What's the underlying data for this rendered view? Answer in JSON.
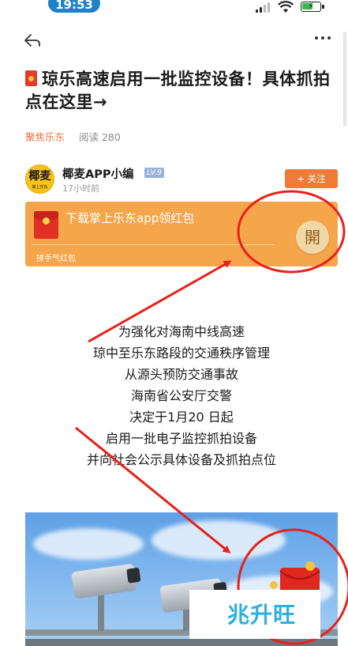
{
  "status_bar": {
    "time": "19:53"
  },
  "article": {
    "title": "琼乐高速启用一批监控设备！具体抓拍点在这里→",
    "source": "聚焦乐东",
    "read_label": "阅读 280"
  },
  "author": {
    "avatar_text": "椰麦",
    "avatar_subtext": "掌上乐东",
    "name": "椰麦APP小编",
    "level": "LV.9",
    "time": "17小时前",
    "follow_label": "+  关注"
  },
  "redpacket_banner": {
    "text": "下载掌上乐东app领红包",
    "footer": "拼手气红包",
    "open_label": "開"
  },
  "body_lines": [
    "为强化对海南中线高速",
    "琼中至乐东路段的交通秩序管理",
    "从源头预防交通事故",
    "海南省公安厅交警",
    "决定于1月20 日起",
    "启用一批电子监控抓拍设备",
    "并向社会公示具体设备及抓拍点位"
  ],
  "watermark": "兆升旺",
  "colors": {
    "accent": "#f07a3a",
    "banner": "#f5a54a",
    "annotation_red": "#e8201a",
    "status_time_bg": "#1e82c8"
  },
  "icons": [
    "back-arrow-icon",
    "more-icon",
    "signal-icon",
    "wifi-icon",
    "battery-icon",
    "red-envelope-icon"
  ]
}
